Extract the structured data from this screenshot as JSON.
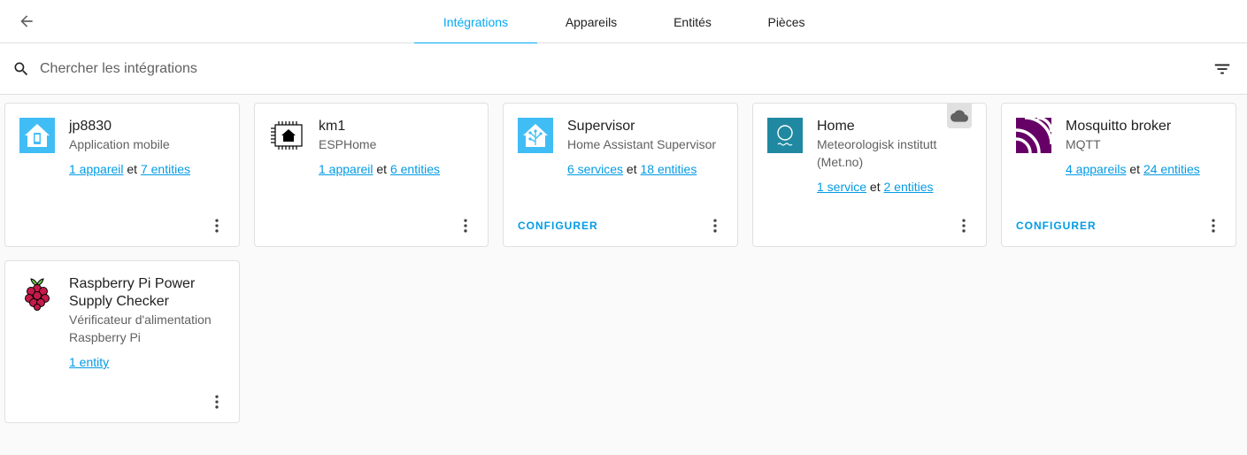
{
  "nav": {
    "tabs": [
      {
        "label": "Intégrations",
        "active": true
      },
      {
        "label": "Appareils",
        "active": false
      },
      {
        "label": "Entités",
        "active": false
      },
      {
        "label": "Pièces",
        "active": false
      }
    ]
  },
  "search": {
    "placeholder": "Chercher les intégrations"
  },
  "colors": {
    "accent": "#03a9f4",
    "link": "#039be5",
    "mqtt": "#660066",
    "met": "#2089a1",
    "ha_blue": "#41bdf5"
  },
  "cards": [
    {
      "title": "jp8830",
      "subtitle": "Application mobile",
      "link1": "1 appareil",
      "sep": "et",
      "link2": "7 entities",
      "icon": "mobile-app-icon"
    },
    {
      "title": "km1",
      "subtitle": "ESPHome",
      "link1": "1 appareil",
      "sep": "et",
      "link2": "6 entities",
      "icon": "esphome-icon"
    },
    {
      "title": "Supervisor",
      "subtitle": "Home Assistant Supervisor",
      "link1": "6 services",
      "sep": "et",
      "link2": "18 entities",
      "configure": "CONFIGURER",
      "icon": "supervisor-icon"
    },
    {
      "title": "Home",
      "subtitle": "Meteorologisk institutt (Met.no)",
      "link1": "1 service",
      "sep": "et",
      "link2": "2 entities",
      "icon": "met-icon",
      "badge": "cloud-icon"
    },
    {
      "title": "Mosquitto broker",
      "subtitle": "MQTT",
      "link1": "4 appareils",
      "sep": "et",
      "link2": "24 entities",
      "configure": "CONFIGURER",
      "icon": "mqtt-icon"
    },
    {
      "title": "Raspberry Pi Power Supply Checker",
      "subtitle": "Vérificateur d'alimentation Raspberry Pi",
      "link1": "1 entity",
      "icon": "raspberry-pi-icon"
    }
  ]
}
